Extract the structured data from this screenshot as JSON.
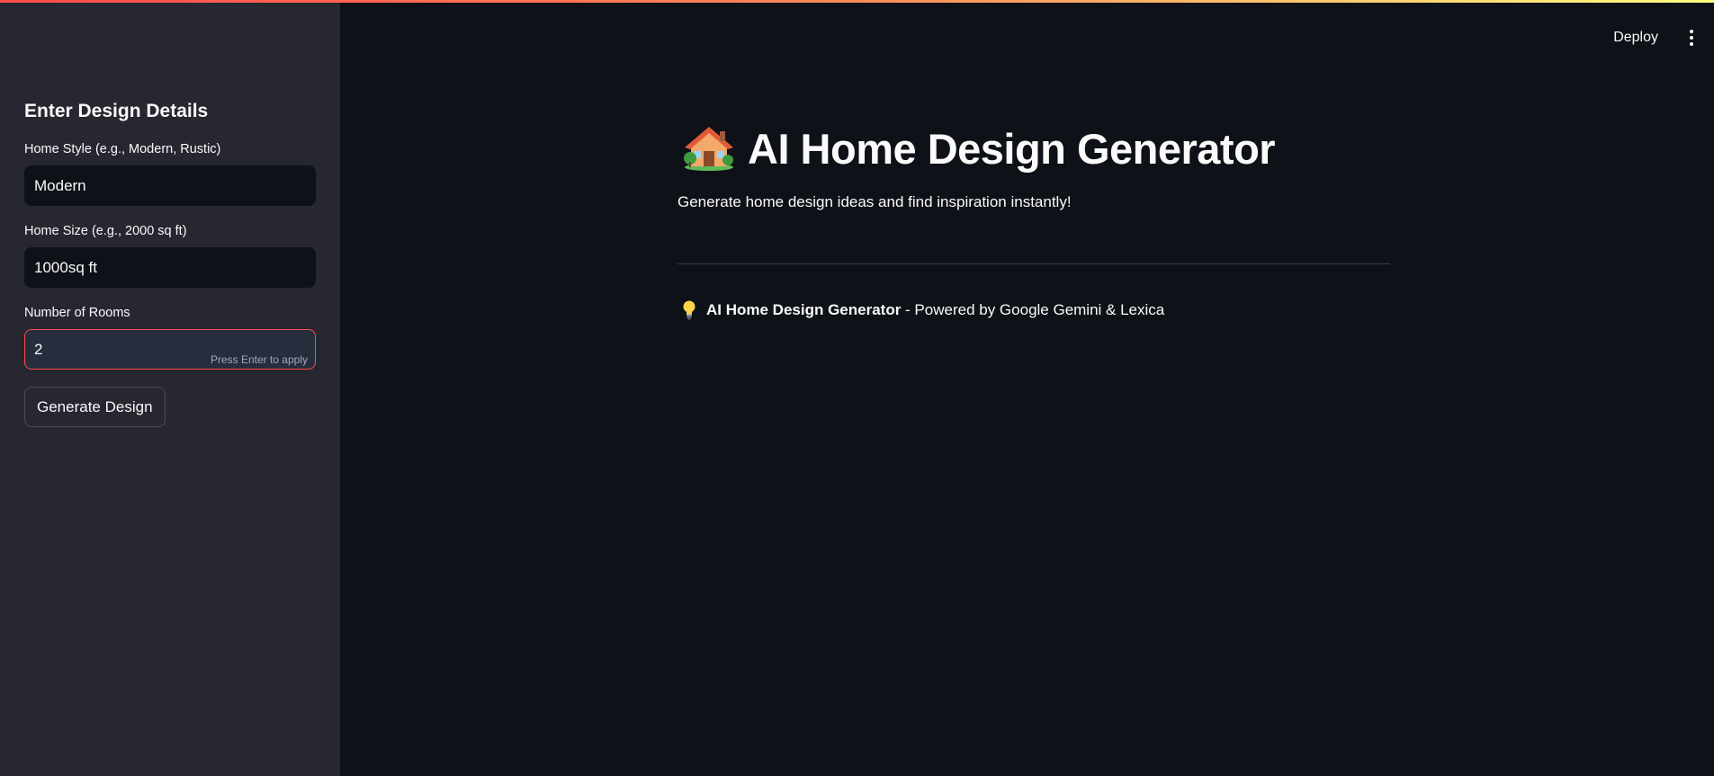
{
  "sidebar": {
    "title": "Enter Design Details",
    "fields": [
      {
        "label": "Home Style (e.g., Modern, Rustic)",
        "value": "Modern"
      },
      {
        "label": "Home Size (e.g., 2000 sq ft)",
        "value": "1000sq ft"
      },
      {
        "label": "Number of Rooms",
        "value": "2",
        "hint": "Press Enter to apply"
      }
    ],
    "button_label": "Generate Design"
  },
  "header": {
    "deploy_label": "Deploy",
    "menu_icon": "kebab-menu-icon"
  },
  "main": {
    "title_icon": "house-with-garden-icon",
    "title": "AI Home Design Generator",
    "subtitle": "Generate home design ideas and find inspiration instantly!",
    "footer": {
      "icon": "light-bulb-icon",
      "bold_text": "AI Home Design Generator",
      "text": " - Powered by Google Gemini & Lexica"
    }
  },
  "colors": {
    "background": "#0e1117",
    "sidebar": "#262730",
    "accent": "#ff4b4b",
    "text": "#fafafa"
  }
}
